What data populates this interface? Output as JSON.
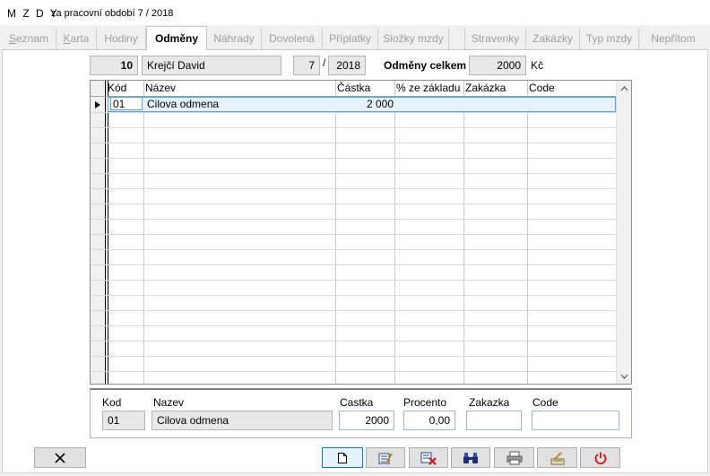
{
  "window": {
    "title": "M Z D Y",
    "subtitle": "za pracovní období  7 / 2018"
  },
  "tabs": [
    {
      "label": "Seznam",
      "underline": "S",
      "rest": "eznam"
    },
    {
      "label": "Karta",
      "underline": "K",
      "rest": "arta"
    },
    {
      "label": "Hodiny"
    },
    {
      "label": "Odměny"
    },
    {
      "label": "Náhrady"
    },
    {
      "label": "Dovolená"
    },
    {
      "label": "Příplatky"
    },
    {
      "label": "Složky mzdy"
    },
    {
      "label": ""
    },
    {
      "label": "Stravenky"
    },
    {
      "label": "Zakázky"
    },
    {
      "label": "Typ mzdy"
    },
    {
      "label": "Nepřítom"
    }
  ],
  "header": {
    "employee_number": "10",
    "employee_name": "Krejčí David",
    "month": "7",
    "separator": "/",
    "year": "2018",
    "total_label": "Odměny celkem",
    "total_value": "2000",
    "currency": "Kč"
  },
  "grid": {
    "columns": [
      "Kód",
      "Název",
      "Částka",
      "% ze základu",
      "Zakázka",
      "Code"
    ],
    "rows": [
      {
        "kod": "01",
        "nazev": "Cilova odmena",
        "castka": "2 000",
        "procento": "",
        "zakazka": "",
        "code": ""
      }
    ]
  },
  "detail": {
    "labels": {
      "kod": "Kod",
      "nazev": "Nazev",
      "castka": "Castka",
      "procento": "Procento",
      "zakazka": "Zakazka",
      "code": "Code"
    },
    "kod": "01",
    "nazev": "Cilova odmena",
    "castka": "2000",
    "procento": "0,00",
    "zakazka": "",
    "code": ""
  }
}
